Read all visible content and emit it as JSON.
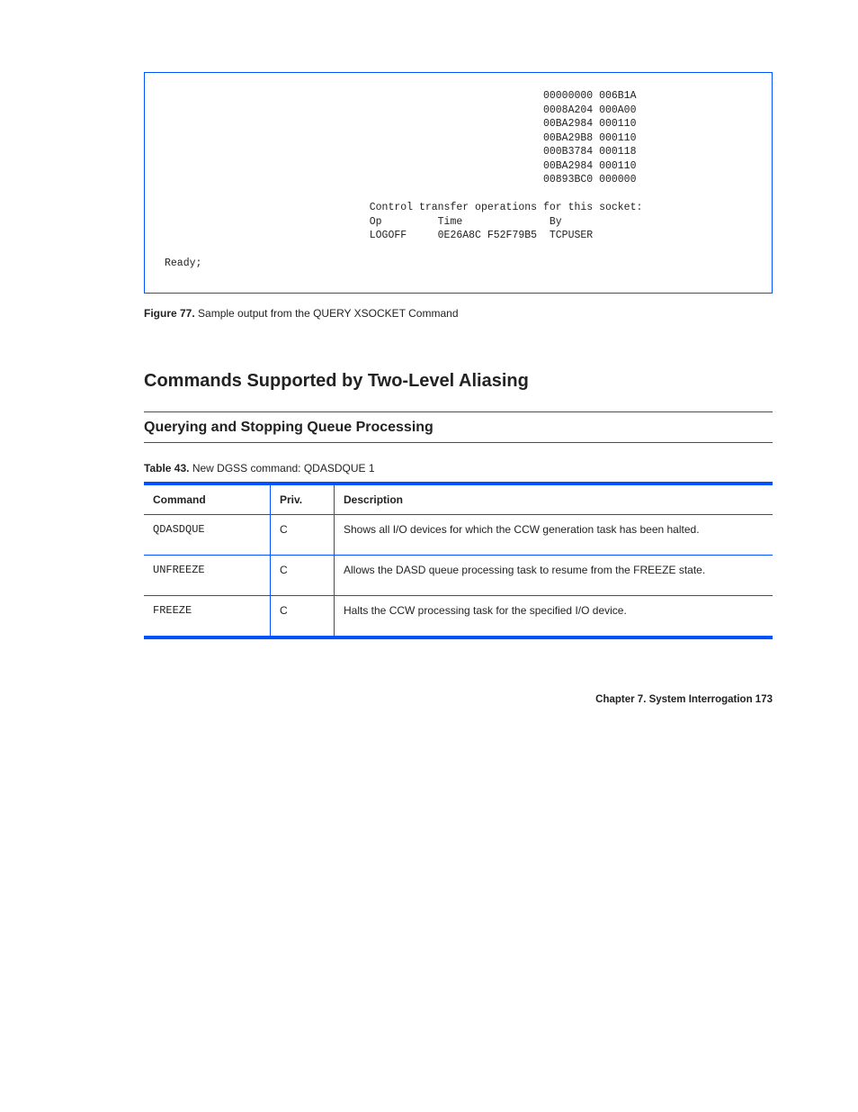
{
  "figure": {
    "code": "                                                             00000000 006B1A\n                                                             0008A204 000A00\n                                                             00BA2984 000110\n                                                             00BA29B8 000110\n                                                             000B3784 000118\n                                                             00BA2984 000110\n                                                             00893BC0 000000\n\n                                 Control transfer operations for this socket:\n                                 Op         Time              By\n                                 LOGOFF     0E26A8C F52F79B5  TCPUSER\n\nReady;",
    "caption_label": "Figure 77.",
    "caption_text": "Sample output from the QUERY XSOCKET Command"
  },
  "section": {
    "heading": "Commands Supported by Two-Level Aliasing",
    "sub_heading": "Querying and Stopping Queue Processing"
  },
  "table": {
    "title_label": "Table 43.",
    "title_text": "New DGSS command: QDASDQUE 1",
    "headers": [
      "Command",
      "Priv.",
      "Description"
    ],
    "rows": [
      {
        "command": "QDASDQUE",
        "priv": "C",
        "description": "Shows all I/O devices for which the CCW generation task has been halted."
      },
      {
        "command": "UNFREEZE",
        "priv": "C",
        "description": "Allows the DASD queue processing task to resume from the FREEZE state."
      },
      {
        "command": "FREEZE",
        "priv": "C",
        "description": "Halts the CCW processing task for the specified I/O device."
      }
    ]
  },
  "footer": {
    "text": "Chapter 7. System Interrogation    173"
  }
}
